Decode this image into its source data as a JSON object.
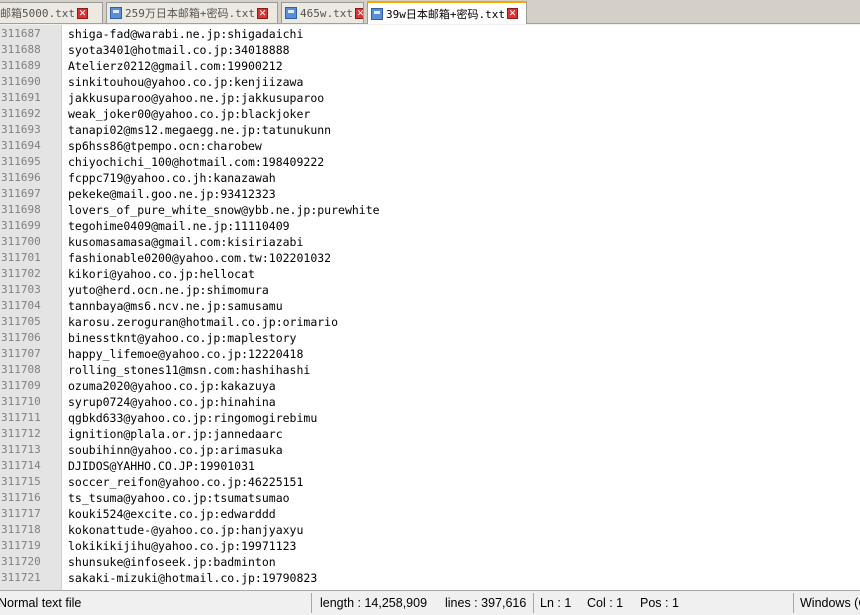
{
  "tabs": [
    {
      "label": "邮箱5000.txt",
      "active": false
    },
    {
      "label": "259万日本邮箱+密码.txt",
      "active": false
    },
    {
      "label": "465w.txt",
      "active": false
    },
    {
      "label": "39w日本邮箱+密码.txt",
      "active": true
    }
  ],
  "icons": {
    "tab_file": "file-icon",
    "tab_close": "close-icon"
  },
  "editor": {
    "lines": [
      {
        "n": "311687",
        "text": "shiga-fad@warabi.ne.jp:shigadaichi"
      },
      {
        "n": "311688",
        "text": "syota3401@hotmail.co.jp:34018888"
      },
      {
        "n": "311689",
        "text": "Atelierz0212@gmail.com:19900212"
      },
      {
        "n": "311690",
        "text": "sinkitouhou@yahoo.co.jp:kenjiizawa"
      },
      {
        "n": "311691",
        "text": "jakkusuparoo@yahoo.ne.jp:jakkusuparoo"
      },
      {
        "n": "311692",
        "text": "weak_joker00@yahoo.co.jp:blackjoker"
      },
      {
        "n": "311693",
        "text": "tanapi02@ms12.megaegg.ne.jp:tatunukunn"
      },
      {
        "n": "311694",
        "text": "sp6hss86@tpempo.ocn:charobew"
      },
      {
        "n": "311695",
        "text": "chiyochichi_100@hotmail.com:198409222"
      },
      {
        "n": "311696",
        "text": "fcppc719@yahoo.co.jh:kanazawah"
      },
      {
        "n": "311697",
        "text": "pekeke@mail.goo.ne.jp:93412323"
      },
      {
        "n": "311698",
        "text": "lovers_of_pure_white_snow@ybb.ne.jp:purewhite"
      },
      {
        "n": "311699",
        "text": "tegohime0409@mail.ne.jp:11110409"
      },
      {
        "n": "311700",
        "text": "kusomasamasa@gmail.com:kisiriazabi"
      },
      {
        "n": "311701",
        "text": "fashionable0200@yahoo.com.tw:102201032"
      },
      {
        "n": "311702",
        "text": "kikori@yahoo.co.jp:hellocat"
      },
      {
        "n": "311703",
        "text": "yuto@herd.ocn.ne.jp:shimomura"
      },
      {
        "n": "311704",
        "text": "tannbaya@ms6.ncv.ne.jp:samusamu"
      },
      {
        "n": "311705",
        "text": "karosu.zeroguran@hotmail.co.jp:orimario"
      },
      {
        "n": "311706",
        "text": "binesstknt@yahoo.co.jp:maplestory"
      },
      {
        "n": "311707",
        "text": "happy_lifemoe@yahoo.co.jp:12220418"
      },
      {
        "n": "311708",
        "text": "rolling_stones11@msn.com:hashihashi"
      },
      {
        "n": "311709",
        "text": "ozuma2020@yahoo.co.jp:kakazuya"
      },
      {
        "n": "311710",
        "text": "syrup0724@yahoo.co.jp:hinahina"
      },
      {
        "n": "311711",
        "text": "qgbkd633@yahoo.co.jp:ringomogirebimu"
      },
      {
        "n": "311712",
        "text": "ignition@plala.or.jp:jannedaarc"
      },
      {
        "n": "311713",
        "text": "soubihinn@yahoo.co.jp:arimasuka"
      },
      {
        "n": "311714",
        "text": "DJIDOS@YAHHO.CO.JP:19901031"
      },
      {
        "n": "311715",
        "text": "soccer_reifon@yahoo.co.jp:46225151"
      },
      {
        "n": "311716",
        "text": "ts_tsuma@yahoo.co.jp:tsumatsumao"
      },
      {
        "n": "311717",
        "text": "kouki524@excite.co.jp:edwarddd"
      },
      {
        "n": "311718",
        "text": "kokonattude-@yahoo.co.jp:hanjyaxyu"
      },
      {
        "n": "311719",
        "text": "lokikikijihu@yahoo.co.jp:19971123"
      },
      {
        "n": "311720",
        "text": "shunsuke@infoseek.jp:badminton"
      },
      {
        "n": "311721",
        "text": "sakaki-mizuki@hotmail.co.jp:19790823"
      }
    ]
  },
  "statusbar": {
    "file_type": "Normal text file",
    "length": "length : 14,258,909",
    "lines": "lines : 397,616",
    "ln": "Ln : 1",
    "col": "Col : 1",
    "pos": "Pos : 1",
    "eol": "Windows (CR LF)"
  }
}
